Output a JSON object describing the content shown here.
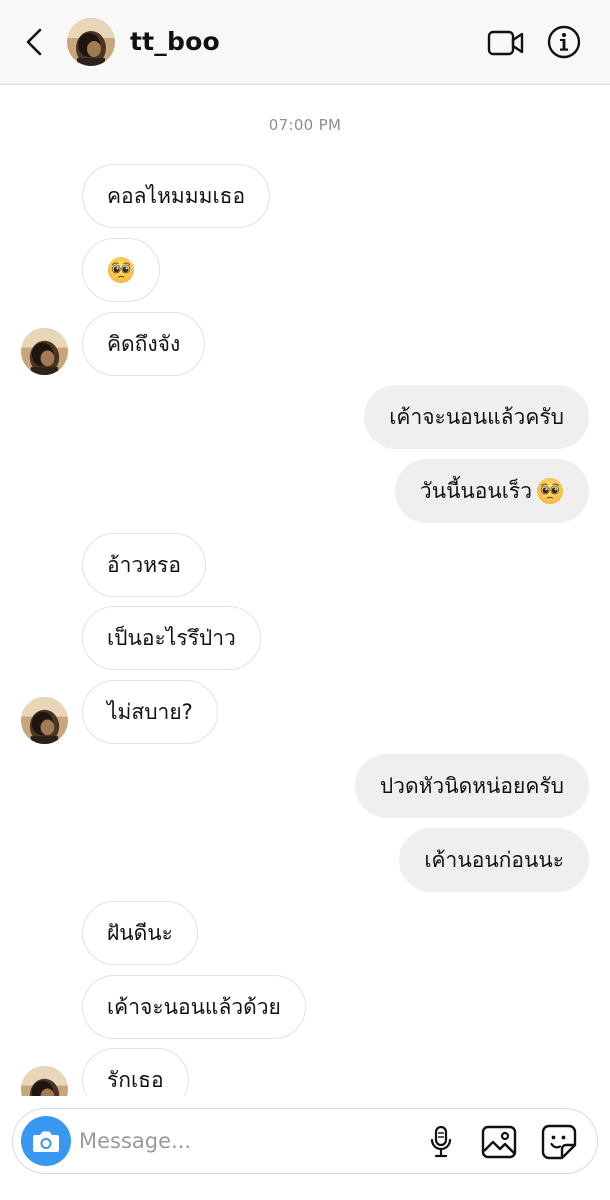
{
  "header": {
    "username": "tt_boo",
    "icons": {
      "back": "chevron-left-icon",
      "video": "video-camera-icon",
      "info": "info-icon"
    }
  },
  "thread": {
    "timestamp": "07:00 PM",
    "messages": [
      {
        "direction": "in",
        "text": "คอลไหมมมเธอ",
        "emoji": ""
      },
      {
        "direction": "in",
        "text": "",
        "emoji": "pleading-face"
      },
      {
        "direction": "in",
        "text": "คิดถึงจัง",
        "emoji": "",
        "avatar": true
      },
      {
        "direction": "out",
        "text": "เค้าจะนอนแล้วครับ",
        "emoji": ""
      },
      {
        "direction": "out",
        "text": "วันนี้นอนเร็ว",
        "emoji": "pleading-face"
      },
      {
        "direction": "in",
        "text": "อ้าวหรอ",
        "emoji": ""
      },
      {
        "direction": "in",
        "text": "เป็นอะไรรึป่าว",
        "emoji": ""
      },
      {
        "direction": "in",
        "text": "ไม่สบาย?",
        "emoji": "",
        "avatar": true
      },
      {
        "direction": "out",
        "text": "ปวดหัวนิดหน่อยครับ",
        "emoji": ""
      },
      {
        "direction": "out",
        "text": "เค้านอนก่อนนะ",
        "emoji": ""
      },
      {
        "direction": "in",
        "text": "ฝันดีนะ",
        "emoji": ""
      },
      {
        "direction": "in",
        "text": "เค้าจะนอนแล้วด้วย",
        "emoji": ""
      },
      {
        "direction": "in",
        "text": "รักเธอ",
        "emoji": "",
        "avatar": true
      }
    ]
  },
  "composer": {
    "placeholder": "Message...",
    "value": "",
    "icons": {
      "camera": "camera-icon",
      "mic": "microphone-icon",
      "gallery": "image-gallery-icon",
      "sticker": "sticker-icon"
    }
  },
  "colors": {
    "accent": "#3897f0",
    "incoming_bubble": "#ffffff",
    "outgoing_bubble": "#efefef",
    "header_bg": "#f8f8f8",
    "timestamp": "#8e8e8e"
  }
}
